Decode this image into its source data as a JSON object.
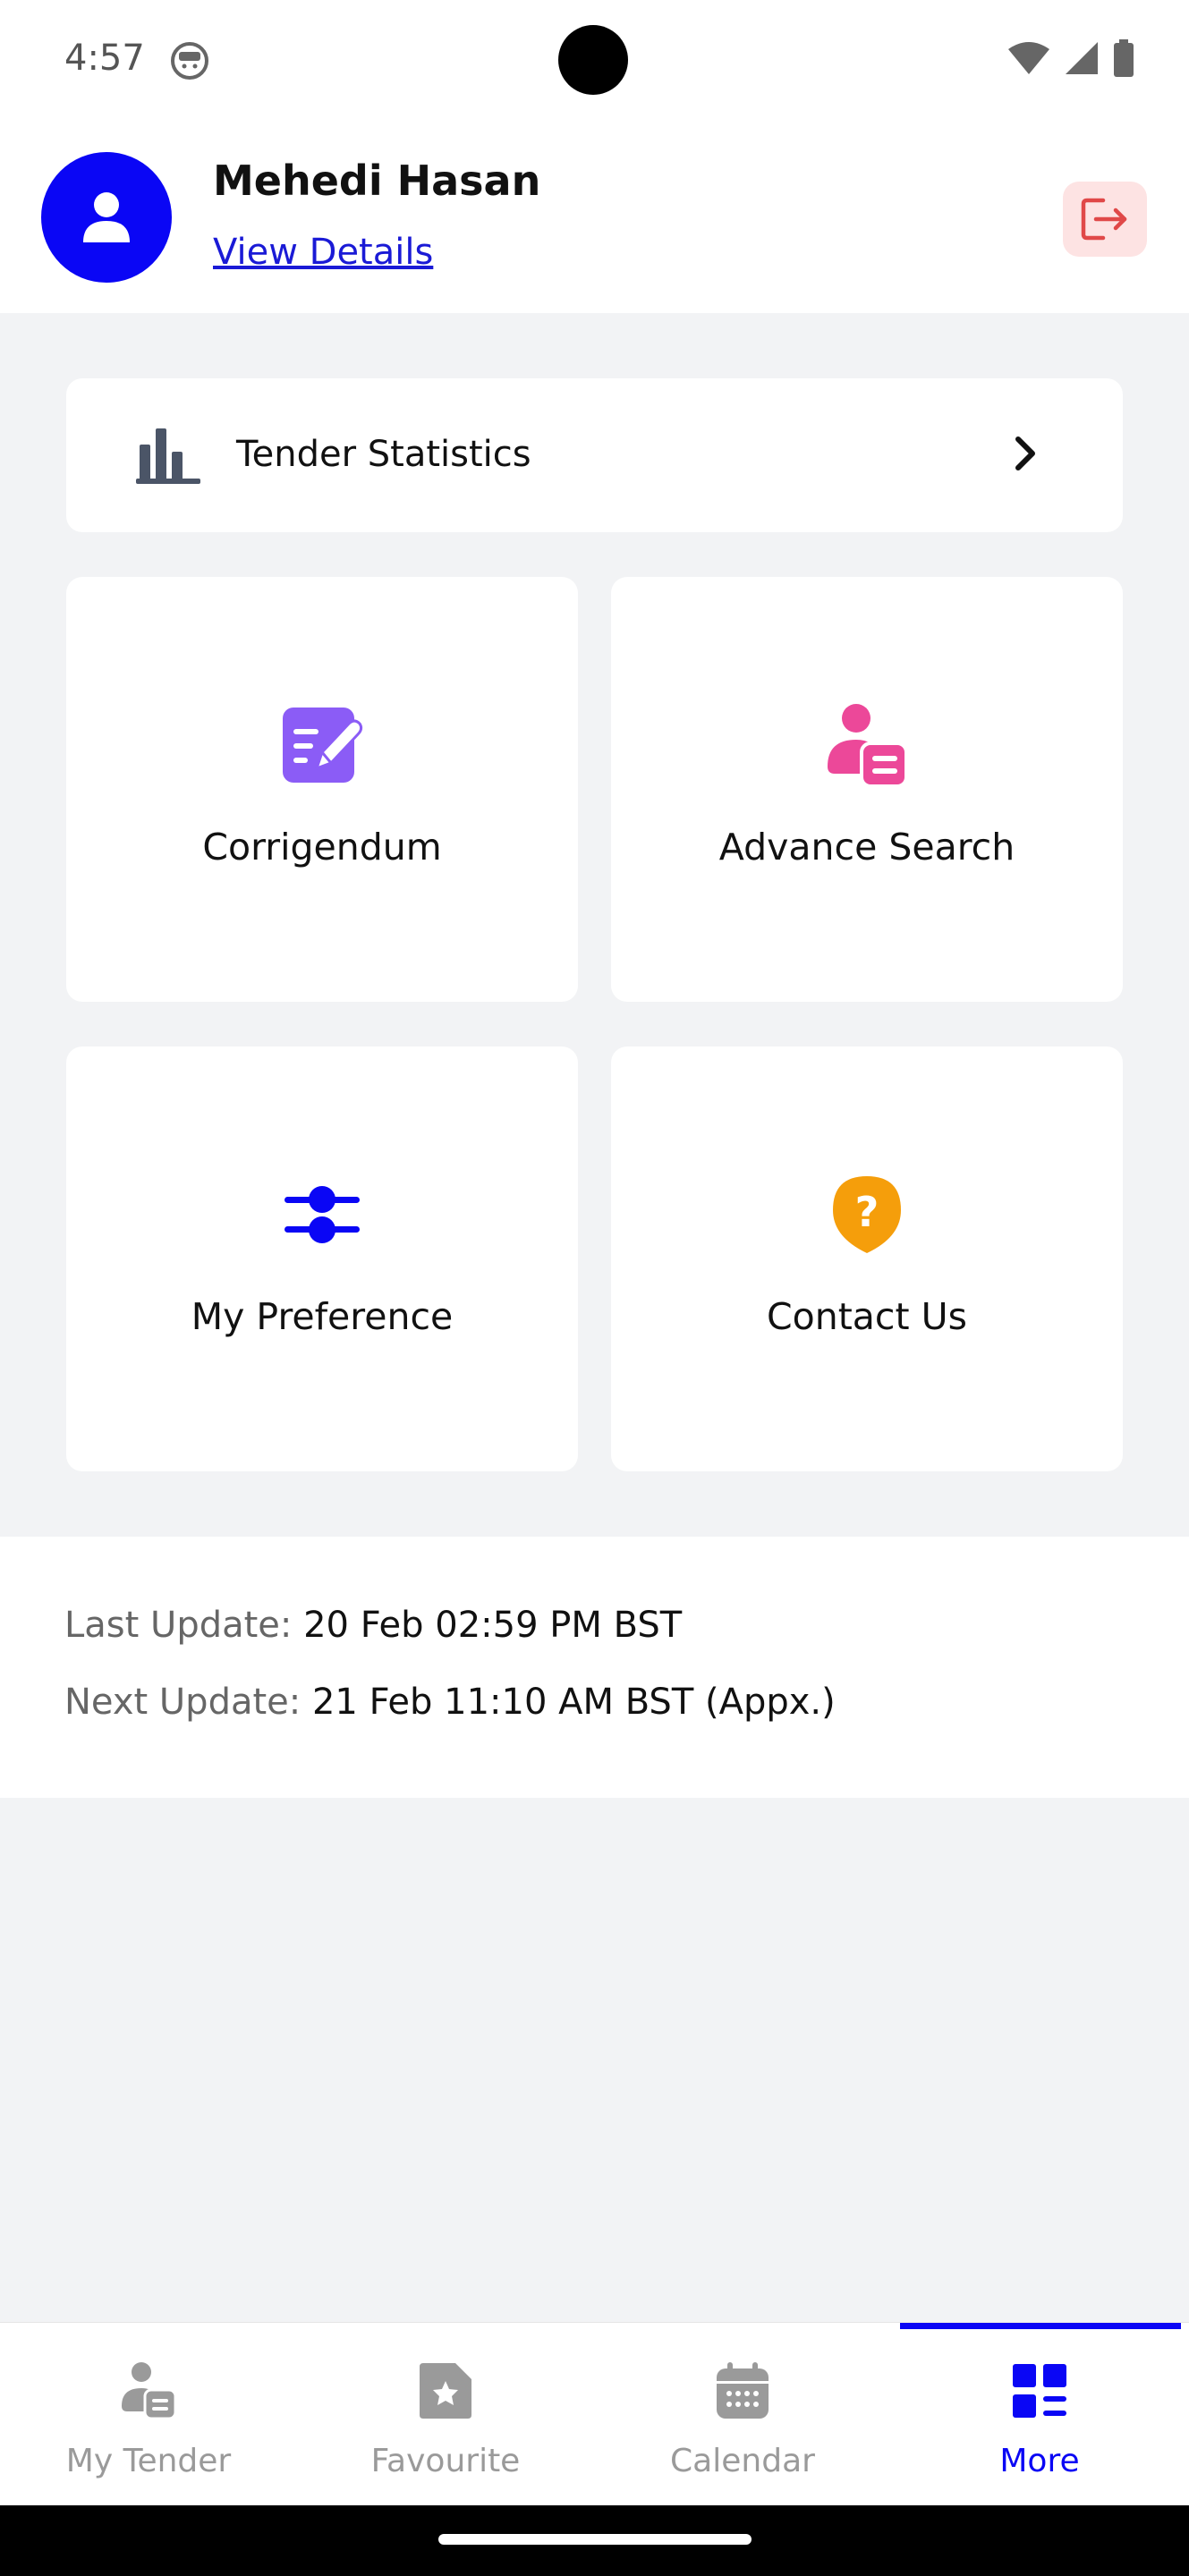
{
  "status_bar": {
    "time": "4:57"
  },
  "header": {
    "user_name": "Mehedi Hasan",
    "view_details": "View Details"
  },
  "tender_statistics": {
    "label": "Tender Statistics"
  },
  "tiles": [
    {
      "label": "Corrigendum",
      "icon": "edit-document-icon",
      "color": "#8b5cf6"
    },
    {
      "label": "Advance Search",
      "icon": "person-list-icon",
      "color": "#ec4899"
    },
    {
      "label": "My Preference",
      "icon": "sliders-icon",
      "color": "#0a06f5"
    },
    {
      "label": "Contact Us",
      "icon": "question-bubble-icon",
      "color": "#f59e0b"
    }
  ],
  "updates": {
    "last_label": "Last Update:",
    "last_value": "20 Feb 02:59 PM BST",
    "next_label": "Next Update:",
    "next_value": "21 Feb 11:10 AM BST (Appx.)"
  },
  "bottom_nav": {
    "items": [
      {
        "label": "My Tender",
        "icon": "person-list-icon"
      },
      {
        "label": "Favourite",
        "icon": "star-document-icon"
      },
      {
        "label": "Calendar",
        "icon": "calendar-icon"
      },
      {
        "label": "More",
        "icon": "grid-more-icon"
      }
    ],
    "active": "More"
  },
  "colors": {
    "accent": "#0a06f5",
    "logout_bg": "#fde3e3",
    "logout_icon": "#e04848"
  }
}
